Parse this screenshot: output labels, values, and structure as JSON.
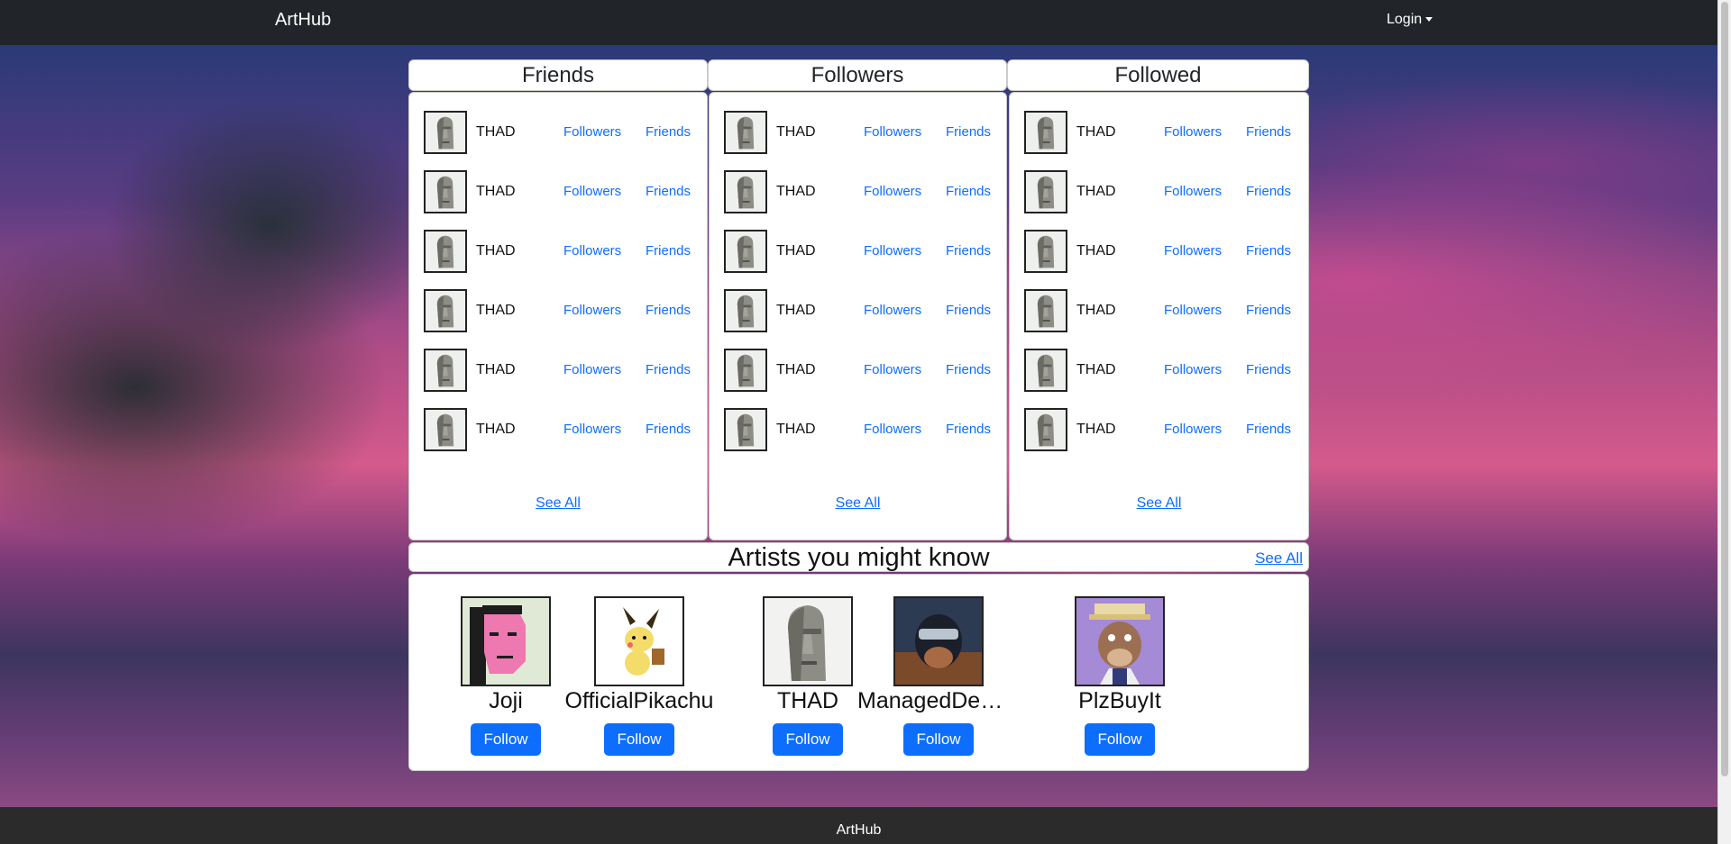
{
  "nav": {
    "brand": "ArtHub",
    "login": "Login"
  },
  "columns": [
    {
      "title": "Friends",
      "see_all": "See All",
      "rows": [
        {
          "name": "THAD",
          "link1": "Followers",
          "link2": "Friends"
        },
        {
          "name": "THAD",
          "link1": "Followers",
          "link2": "Friends"
        },
        {
          "name": "THAD",
          "link1": "Followers",
          "link2": "Friends"
        },
        {
          "name": "THAD",
          "link1": "Followers",
          "link2": "Friends"
        },
        {
          "name": "THAD",
          "link1": "Followers",
          "link2": "Friends"
        },
        {
          "name": "THAD",
          "link1": "Followers",
          "link2": "Friends"
        }
      ]
    },
    {
      "title": "Followers",
      "see_all": "See All",
      "rows": [
        {
          "name": "THAD",
          "link1": "Followers",
          "link2": "Friends"
        },
        {
          "name": "THAD",
          "link1": "Followers",
          "link2": "Friends"
        },
        {
          "name": "THAD",
          "link1": "Followers",
          "link2": "Friends"
        },
        {
          "name": "THAD",
          "link1": "Followers",
          "link2": "Friends"
        },
        {
          "name": "THAD",
          "link1": "Followers",
          "link2": "Friends"
        },
        {
          "name": "THAD",
          "link1": "Followers",
          "link2": "Friends"
        }
      ]
    },
    {
      "title": "Followed",
      "see_all": "See All",
      "rows": [
        {
          "name": "THAD",
          "link1": "Followers",
          "link2": "Friends"
        },
        {
          "name": "THAD",
          "link1": "Followers",
          "link2": "Friends"
        },
        {
          "name": "THAD",
          "link1": "Followers",
          "link2": "Friends"
        },
        {
          "name": "THAD",
          "link1": "Followers",
          "link2": "Friends"
        },
        {
          "name": "THAD",
          "link1": "Followers",
          "link2": "Friends"
        },
        {
          "name": "THAD",
          "link1": "Followers",
          "link2": "Friends"
        }
      ]
    }
  ],
  "artists": {
    "title": "Artists you might know",
    "see_all": "See All",
    "items": [
      {
        "name": "Joji",
        "button": "Follow",
        "avatar": "pink-pixel-face"
      },
      {
        "name": "OfficialPikachu",
        "button": "Follow",
        "avatar": "pikachu"
      },
      {
        "name": "THAD",
        "button": "Follow",
        "avatar": "moai"
      },
      {
        "name": "ManagedDemo...",
        "button": "Follow",
        "avatar": "helmet-portrait"
      },
      {
        "name": "PlzBuyIt",
        "button": "Follow",
        "avatar": "ape"
      }
    ]
  },
  "footer": {
    "text": "ArtHub"
  },
  "colors": {
    "link": "#0d6efd",
    "navbar": "#212529",
    "footer": "#2b2b2b",
    "button": "#0d6efd"
  }
}
